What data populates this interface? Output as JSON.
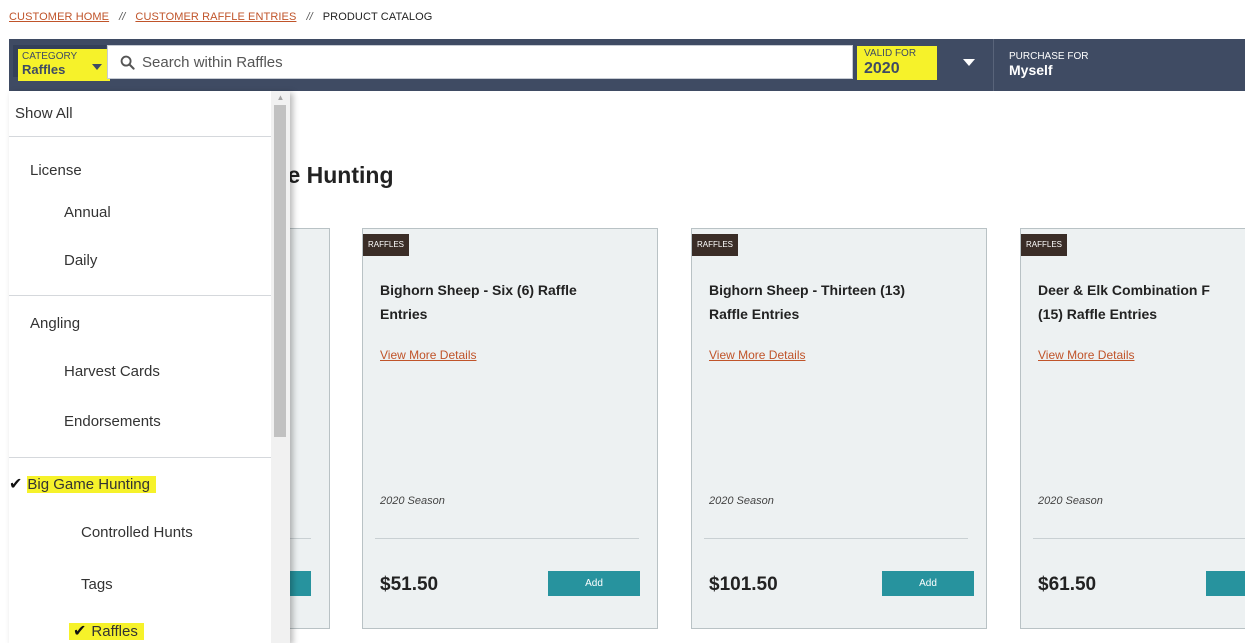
{
  "breadcrumb": {
    "items": [
      "CUSTOMER HOME",
      "CUSTOMER RAFFLE ENTRIES",
      "PRODUCT CATALOG"
    ],
    "separator": "//"
  },
  "topbar": {
    "category_label": "CATEGORY",
    "category_value": "Raffles",
    "search_placeholder": "Search within Raffles",
    "valid_for_label": "VALID FOR",
    "valid_for_value": "2020",
    "purchase_for_label": "PURCHASE FOR",
    "purchase_for_value": "Myself"
  },
  "section_heading": "me Hunting",
  "cards": [
    {
      "badge": "RAFFLES",
      "title_lines": [
        "Bighorn Sheep - Six (6) Raffle",
        "Entries"
      ],
      "link": "View More Details",
      "season": "2020 Season",
      "price": "$51.50",
      "add_label": "Add"
    },
    {
      "badge": "RAFFLES",
      "title_lines": [
        "Bighorn Sheep - Thirteen (13)",
        "Raffle Entries"
      ],
      "link": "View More Details",
      "season": "2020 Season",
      "price": "$101.50",
      "add_label": "Add"
    },
    {
      "badge": "RAFFLES",
      "title_lines": [
        "Deer & Elk Combination F",
        "(15) Raffle Entries"
      ],
      "link": "View More Details",
      "season": "2020 Season",
      "price": "$61.50",
      "add_label": "Add"
    }
  ],
  "dropdown": {
    "items": [
      {
        "label": "Show All"
      },
      {
        "label": "License"
      },
      {
        "label": "Annual"
      },
      {
        "label": "Daily"
      },
      {
        "label": "Angling"
      },
      {
        "label": "Harvest Cards"
      },
      {
        "label": "Endorsements"
      },
      {
        "label": "Big Game Hunting",
        "selected": true
      },
      {
        "label": "Controlled Hunts"
      },
      {
        "label": "Tags"
      },
      {
        "label": "Raffles",
        "selected": true
      }
    ],
    "check_glyph": "✔"
  },
  "colors": {
    "topbar": "#3f4b63",
    "accent_link": "#c0542a",
    "add_button": "#27939e",
    "badge": "#3a2d27",
    "highlight": "#f6f22a",
    "card_bg": "#edf1f2"
  }
}
